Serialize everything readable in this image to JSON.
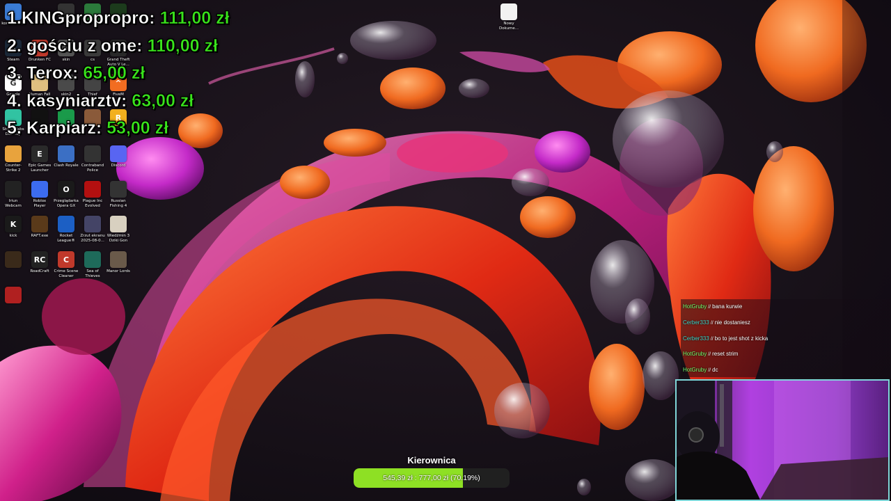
{
  "desktop_icons": [
    {
      "name": "komputer-icon",
      "label": "komputer ...",
      "icon": "computer-icon",
      "color": "#3a7bd5",
      "glyph": ""
    },
    {
      "name": "nvidia-icon",
      "label": "",
      "icon": "app-icon",
      "color": "#2b7a3b",
      "glyph": ""
    },
    {
      "name": "app-icon-2",
      "label": "",
      "icon": "app-icon",
      "color": "#333333",
      "glyph": ""
    },
    {
      "name": "app-icon-3",
      "label": "",
      "icon": "app-icon",
      "color": "#1c3b1c",
      "glyph": ""
    },
    {
      "name": "steam-icon",
      "label": "Steam",
      "icon": "steam-icon",
      "color": "#1b2838",
      "glyph": "S"
    },
    {
      "name": "drunken-fc-icon",
      "label": "Drunken FC",
      "icon": "game-icon",
      "color": "#c0392b",
      "glyph": ""
    },
    {
      "name": "skin-icon",
      "label": "skin",
      "icon": "folder-icon",
      "color": "#555555",
      "glyph": ""
    },
    {
      "name": "cs-icon",
      "label": "cs",
      "icon": "game-icon",
      "color": "#3b3b3b",
      "glyph": ""
    },
    {
      "name": "gta-icon",
      "label": "Grand Theft Auto V Le...",
      "icon": "game-icon",
      "color": "#2a2a2a",
      "glyph": ""
    },
    {
      "name": "google-icon",
      "label": "Google",
      "icon": "chrome-icon",
      "color": "#ffffff",
      "glyph": "G"
    },
    {
      "name": "human-fall-icon",
      "label": "Human Fall",
      "icon": "game-icon",
      "color": "#e0c080",
      "glyph": ""
    },
    {
      "name": "skin2-icon",
      "label": "skin2",
      "icon": "folder-icon",
      "color": "#4a4a4a",
      "glyph": ""
    },
    {
      "name": "thief-icon",
      "label": "Thief",
      "icon": "game-icon",
      "color": "#444444",
      "glyph": ""
    },
    {
      "name": "fivem-icon",
      "label": "FiveM",
      "icon": "fivem-icon",
      "color": "#f26d21",
      "glyph": "^"
    },
    {
      "name": "streamlabs-icon",
      "label": "Streamlabs Desktop",
      "icon": "streamlabs-icon",
      "color": "#31c3a2",
      "glyph": ""
    },
    {
      "name": "tiktok-icon",
      "label": "",
      "icon": "app-icon",
      "color": "#111111",
      "glyph": ""
    },
    {
      "name": "green-app-icon",
      "label": "",
      "icon": "app-icon",
      "color": "#1a9a4a",
      "glyph": ""
    },
    {
      "name": "game-app-icon",
      "label": "",
      "icon": "game-icon",
      "color": "#8a5a3a",
      "glyph": ""
    },
    {
      "name": "rockstar-icon",
      "label": "",
      "icon": "rockstar-icon",
      "color": "#f2b01e",
      "glyph": "R"
    },
    {
      "name": "counter-strike-icon",
      "label": "Counter-Strike 2",
      "icon": "game-icon",
      "color": "#e8a33d",
      "glyph": ""
    },
    {
      "name": "epic-games-icon",
      "label": "Epic Games Launcher",
      "icon": "epic-icon",
      "color": "#2a2a2a",
      "glyph": "E"
    },
    {
      "name": "clash-royale-icon",
      "label": "Clash Royale",
      "icon": "game-icon",
      "color": "#3b6fc4",
      "glyph": ""
    },
    {
      "name": "contraband-police-icon",
      "label": "Contraband Police",
      "icon": "game-icon",
      "color": "#333333",
      "glyph": ""
    },
    {
      "name": "discord-icon",
      "label": "Discord",
      "icon": "discord-icon",
      "color": "#5865f2",
      "glyph": ""
    },
    {
      "name": "iriun-webcam-icon",
      "label": "Iriun Webcam",
      "icon": "webcam-icon",
      "color": "#222222",
      "glyph": ""
    },
    {
      "name": "roblox-player-icon",
      "label": "Roblox Player",
      "icon": "roblox-icon",
      "color": "#3c6cf0",
      "glyph": ""
    },
    {
      "name": "opera-gx-icon",
      "label": "Przeglądarka Opera GX",
      "icon": "opera-icon",
      "color": "#1a1a1a",
      "glyph": "O"
    },
    {
      "name": "plague-inc-icon",
      "label": "Plague Inc Evolved",
      "icon": "biohazard-icon",
      "color": "#b31010",
      "glyph": ""
    },
    {
      "name": "russian-fishing-icon",
      "label": "Russian Fishing 4",
      "icon": "game-icon",
      "color": "#333333",
      "glyph": ""
    },
    {
      "name": "kick-icon",
      "label": "kick",
      "icon": "kick-icon",
      "color": "#1a1a1a",
      "glyph": "K"
    },
    {
      "name": "raft-icon",
      "label": "RAFT.exe",
      "icon": "game-icon",
      "color": "#5a3a1a",
      "glyph": ""
    },
    {
      "name": "rocket-league-icon",
      "label": "Rocket League®",
      "icon": "rocket-league-icon",
      "color": "#1c5fc4",
      "glyph": ""
    },
    {
      "name": "screenshot-icon",
      "label": "Zrzut ekranu 2025-08-0...",
      "icon": "image-icon",
      "color": "#444466",
      "glyph": ""
    },
    {
      "name": "witcher-icon",
      "label": "Wiedźmin 3 Dziki Gon",
      "icon": "game-icon",
      "color": "#d8d0c0",
      "glyph": ""
    },
    {
      "name": "tc-icon",
      "label": "",
      "icon": "game-icon",
      "color": "#3a2a1a",
      "glyph": ""
    },
    {
      "name": "roadcraft-icon",
      "label": "RoadCraft",
      "icon": "game-icon",
      "color": "#222222",
      "glyph": "RC"
    },
    {
      "name": "crime-scene-cleaner-icon",
      "label": "Crime Scene Cleaner",
      "icon": "game-icon",
      "color": "#c0392b",
      "glyph": "C"
    },
    {
      "name": "sea-of-thieves-icon",
      "label": "Sea of Thieves",
      "icon": "game-icon",
      "color": "#1e6a5a",
      "glyph": ""
    },
    {
      "name": "manor-lords-icon",
      "label": "Manor Lords",
      "icon": "game-icon",
      "color": "#6a5a4a",
      "glyph": ""
    },
    {
      "name": "bus-icon",
      "label": "",
      "icon": "game-icon",
      "color": "#b02020",
      "glyph": ""
    },
    {
      "name": "nowy-dokument-icon",
      "label": "Nowy Dokume...",
      "icon": "document-icon",
      "color": "#f2f2f2",
      "glyph": ""
    }
  ],
  "leaderboard": [
    {
      "rank": "1.",
      "name": "KINGpropropro:",
      "amount": "111,00 zł"
    },
    {
      "rank": "2.",
      "name": "gościu z ome:",
      "amount": "110,00 zł"
    },
    {
      "rank": "3.",
      "name": "Terox:",
      "amount": "65,00 zł"
    },
    {
      "rank": "4.",
      "name": "kasyniarztv:",
      "amount": "63,00 zł"
    },
    {
      "rank": "5.",
      "name": "Karpiarz:",
      "amount": "53,00 zł"
    }
  ],
  "chat": [
    {
      "user": "HotGruby",
      "user_color": "#6cff6c",
      "text": "bana kurwie"
    },
    {
      "user": "Cerber333",
      "user_color": "#3ad6c8",
      "text": "nie dostaniesz"
    },
    {
      "user": "Cerber333",
      "user_color": "#3ad6c8",
      "text": "bo to jest shot z kicka"
    },
    {
      "user": "HotGruby",
      "user_color": "#6cff6c",
      "text": "reset strim"
    },
    {
      "user": "HotGruby",
      "user_color": "#6cff6c",
      "text": "dc"
    }
  ],
  "chat_separator": "//",
  "goal": {
    "title": "Kierownica",
    "text": "545,39 zł : 777,00 zł (70.19%)",
    "progress": 0.7019,
    "fill_color": "#8ee024"
  }
}
